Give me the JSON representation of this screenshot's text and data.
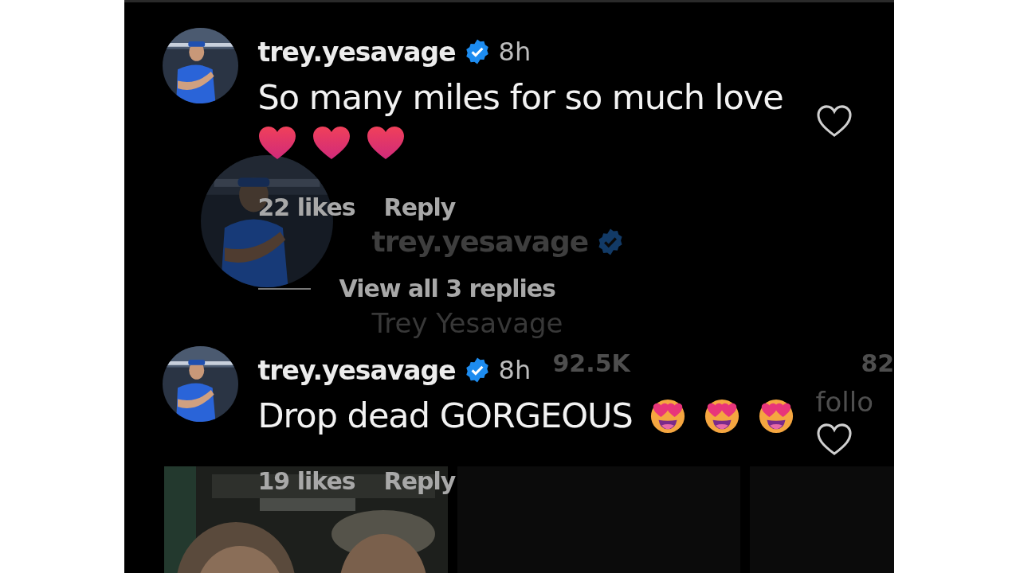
{
  "profile_backdrop": {
    "username": "trey.yesavage",
    "verified": true,
    "full_name": "Trey Yesavage",
    "stats": [
      {
        "value": "92.5K"
      },
      {
        "value": "82",
        "label": "follo"
      }
    ],
    "grid": [
      {
        "kind": "picture"
      },
      {
        "kind": "empty"
      },
      {
        "kind": "empty"
      }
    ]
  },
  "comments": [
    {
      "username": "trey.yesavage",
      "verified": true,
      "time": "8h",
      "text": "So many miles for so much love",
      "emoji": [
        {
          "kind": "heart"
        },
        {
          "kind": "heart"
        },
        {
          "kind": "heart"
        }
      ],
      "likes": "22 likes",
      "reply": "Reply",
      "liked": false,
      "view_replies": "View all 3 replies"
    },
    {
      "username": "trey.yesavage",
      "verified": true,
      "time": "8h",
      "text": "Drop dead GORGEOUS",
      "emoji": [
        {
          "kind": "heart-eyes"
        },
        {
          "kind": "heart-eyes"
        },
        {
          "kind": "heart-eyes"
        }
      ],
      "likes": "19 likes",
      "reply": "Reply",
      "liked": false
    }
  ]
}
